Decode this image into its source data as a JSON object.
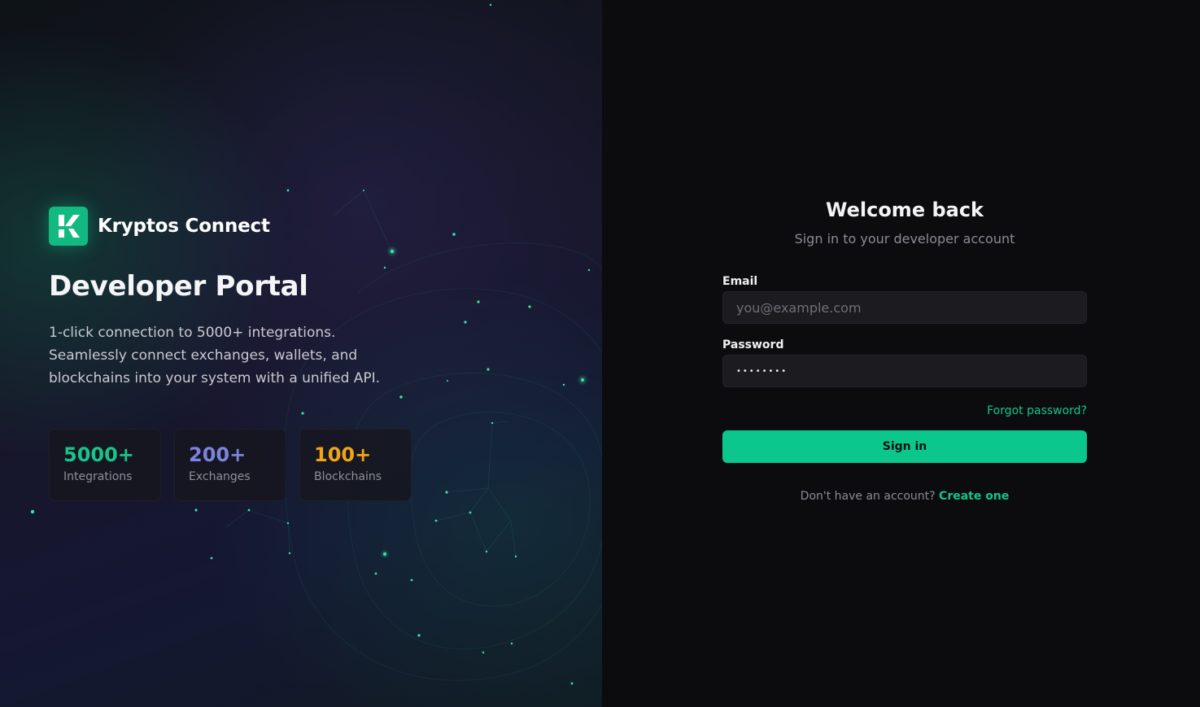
{
  "brand": {
    "name": "Kryptos Connect",
    "logo_icon": "k-logo-icon",
    "accent_color": "#12b981"
  },
  "hero": {
    "title": "Developer Portal",
    "description": "1-click connection to 5000+ integrations. Seamlessly connect exchanges, wallets, and blockchains into your system with a unified API."
  },
  "stats": [
    {
      "value": "5000+",
      "label": "Integrations",
      "color": "#19c38a"
    },
    {
      "value": "200+",
      "label": "Exchanges",
      "color": "#7c83e0"
    },
    {
      "value": "100+",
      "label": "Blockchains",
      "color": "#f0a516"
    }
  ],
  "login": {
    "title": "Welcome back",
    "subtitle": "Sign in to your developer account",
    "email_label": "Email",
    "email_placeholder": "you@example.com",
    "email_value": "",
    "password_label": "Password",
    "password_value": "••••••••",
    "forgot_label": "Forgot password?",
    "submit_label": "Sign in",
    "no_account_text": "Don't have an account?",
    "create_label": "Create one"
  }
}
